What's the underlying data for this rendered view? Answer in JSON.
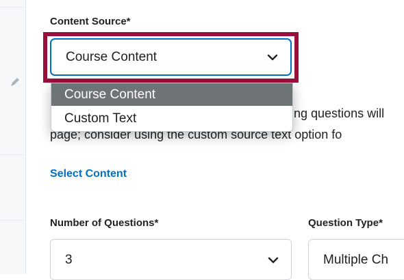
{
  "content_source": {
    "label": "Content Source*",
    "selected": "Course Content",
    "options": [
      "Course Content",
      "Custom Text"
    ]
  },
  "helper_text": {
    "line1": "ing questions will",
    "line2": "page; consider using the custom source text option fo"
  },
  "select_content_link": "Select Content",
  "number_of_questions": {
    "label": "Number of Questions*",
    "value": "3"
  },
  "question_type": {
    "label": "Question Type*",
    "value": "Multiple Ch"
  },
  "colors": {
    "highlight": "#9a0f3c",
    "focus": "#006fbf",
    "selected_option_bg": "#6e7376",
    "link": "#006fbf"
  }
}
